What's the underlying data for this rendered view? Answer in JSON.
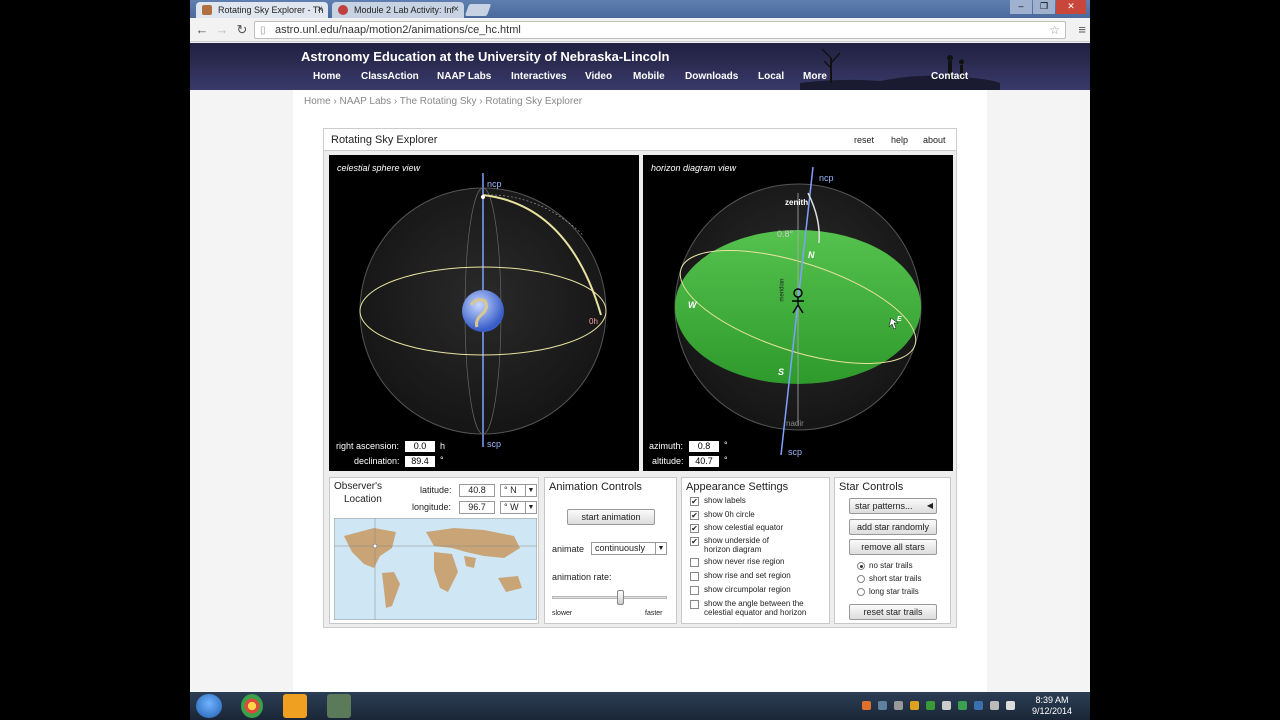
{
  "browser": {
    "tabs": [
      {
        "label": "Rotating Sky Explorer - Th",
        "active": true
      },
      {
        "label": "Module 2 Lab Activity: Inf",
        "active": false
      }
    ],
    "url": "astro.unl.edu/naap/motion2/animations/ce_hc.html",
    "close_glyph": "×"
  },
  "site": {
    "title": "Astronomy Education at the University of Nebraska-Lincoln",
    "nav": [
      "Home",
      "ClassAction",
      "NAAP Labs",
      "Interactives",
      "Video",
      "Mobile",
      "Downloads",
      "Local",
      "More",
      "Contact"
    ]
  },
  "breadcrumb": "Home › NAAP Labs › The Rotating Sky › Rotating Sky Explorer",
  "app": {
    "title": "Rotating Sky Explorer",
    "links": {
      "reset": "reset",
      "help": "help",
      "about": "about"
    },
    "celestial_view": {
      "label": "celestial sphere view",
      "ncp": "ncp",
      "scp": "scp",
      "ra_label": "right ascension:",
      "ra_value": "0.0",
      "ra_unit": "h",
      "dec_label": "declination:",
      "dec_value": "89.4",
      "dec_unit": "°",
      "circle_label": "0h"
    },
    "horizon_view": {
      "label": "horizon diagram view",
      "ncp": "ncp",
      "scp": "scp",
      "zenith": "zenith",
      "nadir": "nadir",
      "N": "N",
      "S": "S",
      "W": "W",
      "E": "E",
      "az_label": "azimuth:",
      "az_value": "0.8",
      "az_unit": "°",
      "alt_label": "altitude:",
      "alt_value": "40.7",
      "alt_unit": "°",
      "meridian": "meridian",
      "circle_label": "0.8°"
    },
    "observer": {
      "title_line1": "Observer's",
      "title_line2": "Location",
      "lat_label": "latitude:",
      "lat_value": "40.8",
      "lat_dir": "° N",
      "lon_label": "longitude:",
      "lon_value": "96.7",
      "lon_dir": "° W"
    },
    "animation": {
      "title": "Animation Controls",
      "start": "start animation",
      "animate_label": "animate",
      "animate_value": "continuously",
      "rate_label": "animation rate:",
      "slower": "slower",
      "faster": "faster",
      "rate": 0.6
    },
    "appearance": {
      "title": "Appearance Settings",
      "options": [
        {
          "line1": "show labels",
          "line2": "",
          "checked": true
        },
        {
          "line1": "show 0h circle",
          "line2": "",
          "checked": true
        },
        {
          "line1": "show celestial equator",
          "line2": "",
          "checked": true
        },
        {
          "line1": "show underside of",
          "line2": "horizon diagram",
          "checked": true
        },
        {
          "line1": "show never rise region",
          "line2": "",
          "checked": false
        },
        {
          "line1": "show rise and set region",
          "line2": "",
          "checked": false
        },
        {
          "line1": "show circumpolar region",
          "line2": "",
          "checked": false
        },
        {
          "line1": "show the angle between the",
          "line2": "celestial equator and horizon",
          "checked": false
        }
      ]
    },
    "stars": {
      "title": "Star Controls",
      "patterns": "star patterns...",
      "add": "add star randomly",
      "remove": "remove all stars",
      "trails": [
        {
          "label": "no star trails",
          "selected": true
        },
        {
          "label": "short star trails",
          "selected": false
        },
        {
          "label": "long star trails",
          "selected": false
        }
      ],
      "reset": "reset star trails"
    }
  },
  "taskbar": {
    "time": "8:39 AM",
    "date": "9/12/2014"
  },
  "colors": {
    "horizon_green": "#3fae3a",
    "equator_yellow": "#e8e2a0",
    "axis_blue": "#7fa0ff",
    "header_dark": "#262648"
  }
}
